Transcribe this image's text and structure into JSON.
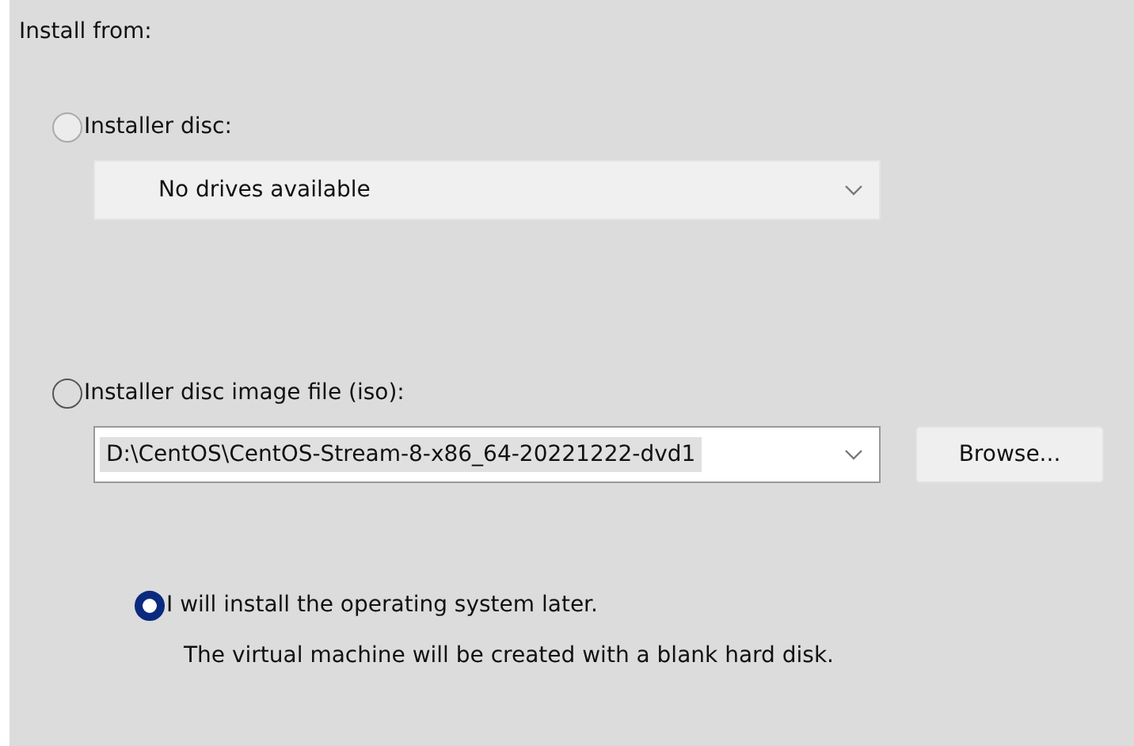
{
  "heading": "Install from:",
  "options": [
    {
      "kind": "dropdown",
      "label": "Installer disc:",
      "selected": false,
      "value": "No drives available",
      "disabled": true
    },
    {
      "kind": "file",
      "label": "Installer disc image file (iso):",
      "selected": false,
      "value": "D:\\CentOS\\CentOS-Stream-8-x86_64-20221222-dvd1",
      "disabled": false,
      "button": "Browse..."
    },
    {
      "kind": "note",
      "label": "I will install the operating system later.",
      "selected": true,
      "note": "The virtual machine will be created with a blank hard disk."
    }
  ]
}
